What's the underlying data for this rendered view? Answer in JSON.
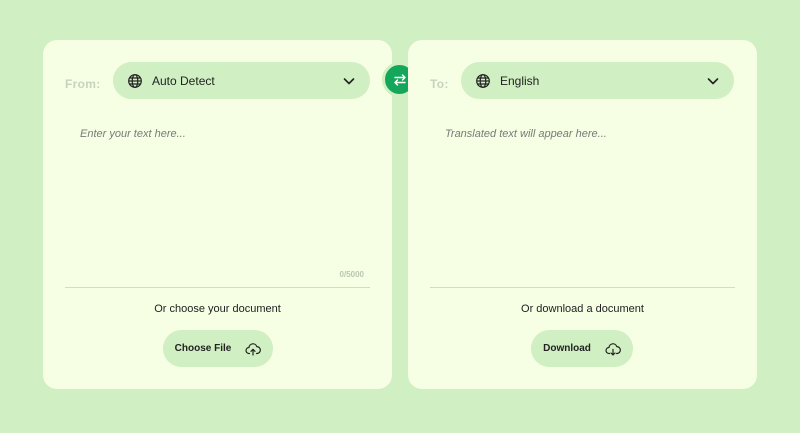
{
  "source": {
    "label": "From:",
    "language": "Auto Detect",
    "placeholder": "Enter your text here...",
    "char_count": "0/5000",
    "doc_caption": "Or choose your document",
    "button_label": "Choose File"
  },
  "target": {
    "label": "To:",
    "language": "English",
    "placeholder": "Translated text will appear here...",
    "doc_caption": "Or download a document",
    "button_label": "Download"
  },
  "icons": {
    "globe": "globe-icon",
    "chevron": "chevron-down-icon",
    "swap": "swap-arrows-icon",
    "upload": "cloud-upload-icon",
    "download": "cloud-download-icon"
  },
  "colors": {
    "background": "#d0efc2",
    "panel": "#f6fee3",
    "accent": "#14a75c",
    "muted_label": "#c7d3bd"
  }
}
